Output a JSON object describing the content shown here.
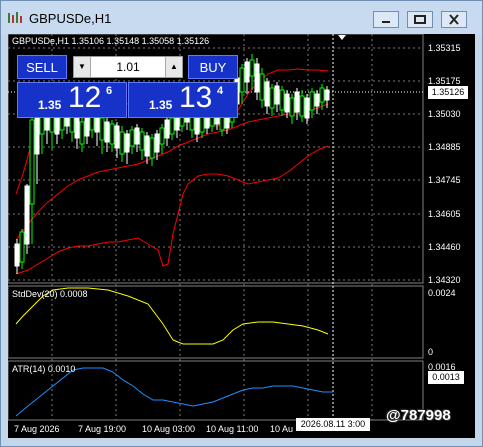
{
  "window": {
    "title": "GBPUSDe,H1",
    "buttons": [
      "minimize",
      "restore",
      "close"
    ]
  },
  "chart": {
    "info_line": "GBPUSDe,H1  1.35106 1.35148 1.35058 1.35126",
    "price_ticks": [
      "1.35315",
      "1.35175",
      "1.35030",
      "1.34885",
      "1.34745",
      "1.34605",
      "1.34460",
      "1.34320"
    ],
    "current_price": "1.35126",
    "time_ticks": [
      "7 Aug 2026",
      "7 Aug 19:00",
      "10 Aug 03:00",
      "10 Aug 11:00",
      "10 Au"
    ],
    "crosshair_time": "2026.08.11 3:00"
  },
  "trade_panel": {
    "sell_label": "SELL",
    "buy_label": "BUY",
    "lot_value": "1.01",
    "lot_dec": "▼",
    "lot_inc": "▲",
    "sell_prefix": "1.35",
    "sell_big": "12",
    "sell_sup": "6",
    "buy_prefix": "1.35",
    "buy_big": "13",
    "buy_sup": "4"
  },
  "indicators": {
    "stddev_label": "StdDev(20) 0.0008",
    "stddev_ticks": [
      "0.0024",
      "0"
    ],
    "atr_label": "ATR(14) 0.0010",
    "atr_ticks": [
      "0.0016"
    ],
    "atr_current": "0.0013"
  },
  "watermark": "@787998",
  "colors": {
    "background": "#000000",
    "bull_candle": "#00ff00",
    "bear_candle": "#ffffff",
    "bollinger": "#ff0000",
    "stddev": "#ffff00",
    "atr": "#1e90ff",
    "trade_button": "#1732c9"
  }
}
